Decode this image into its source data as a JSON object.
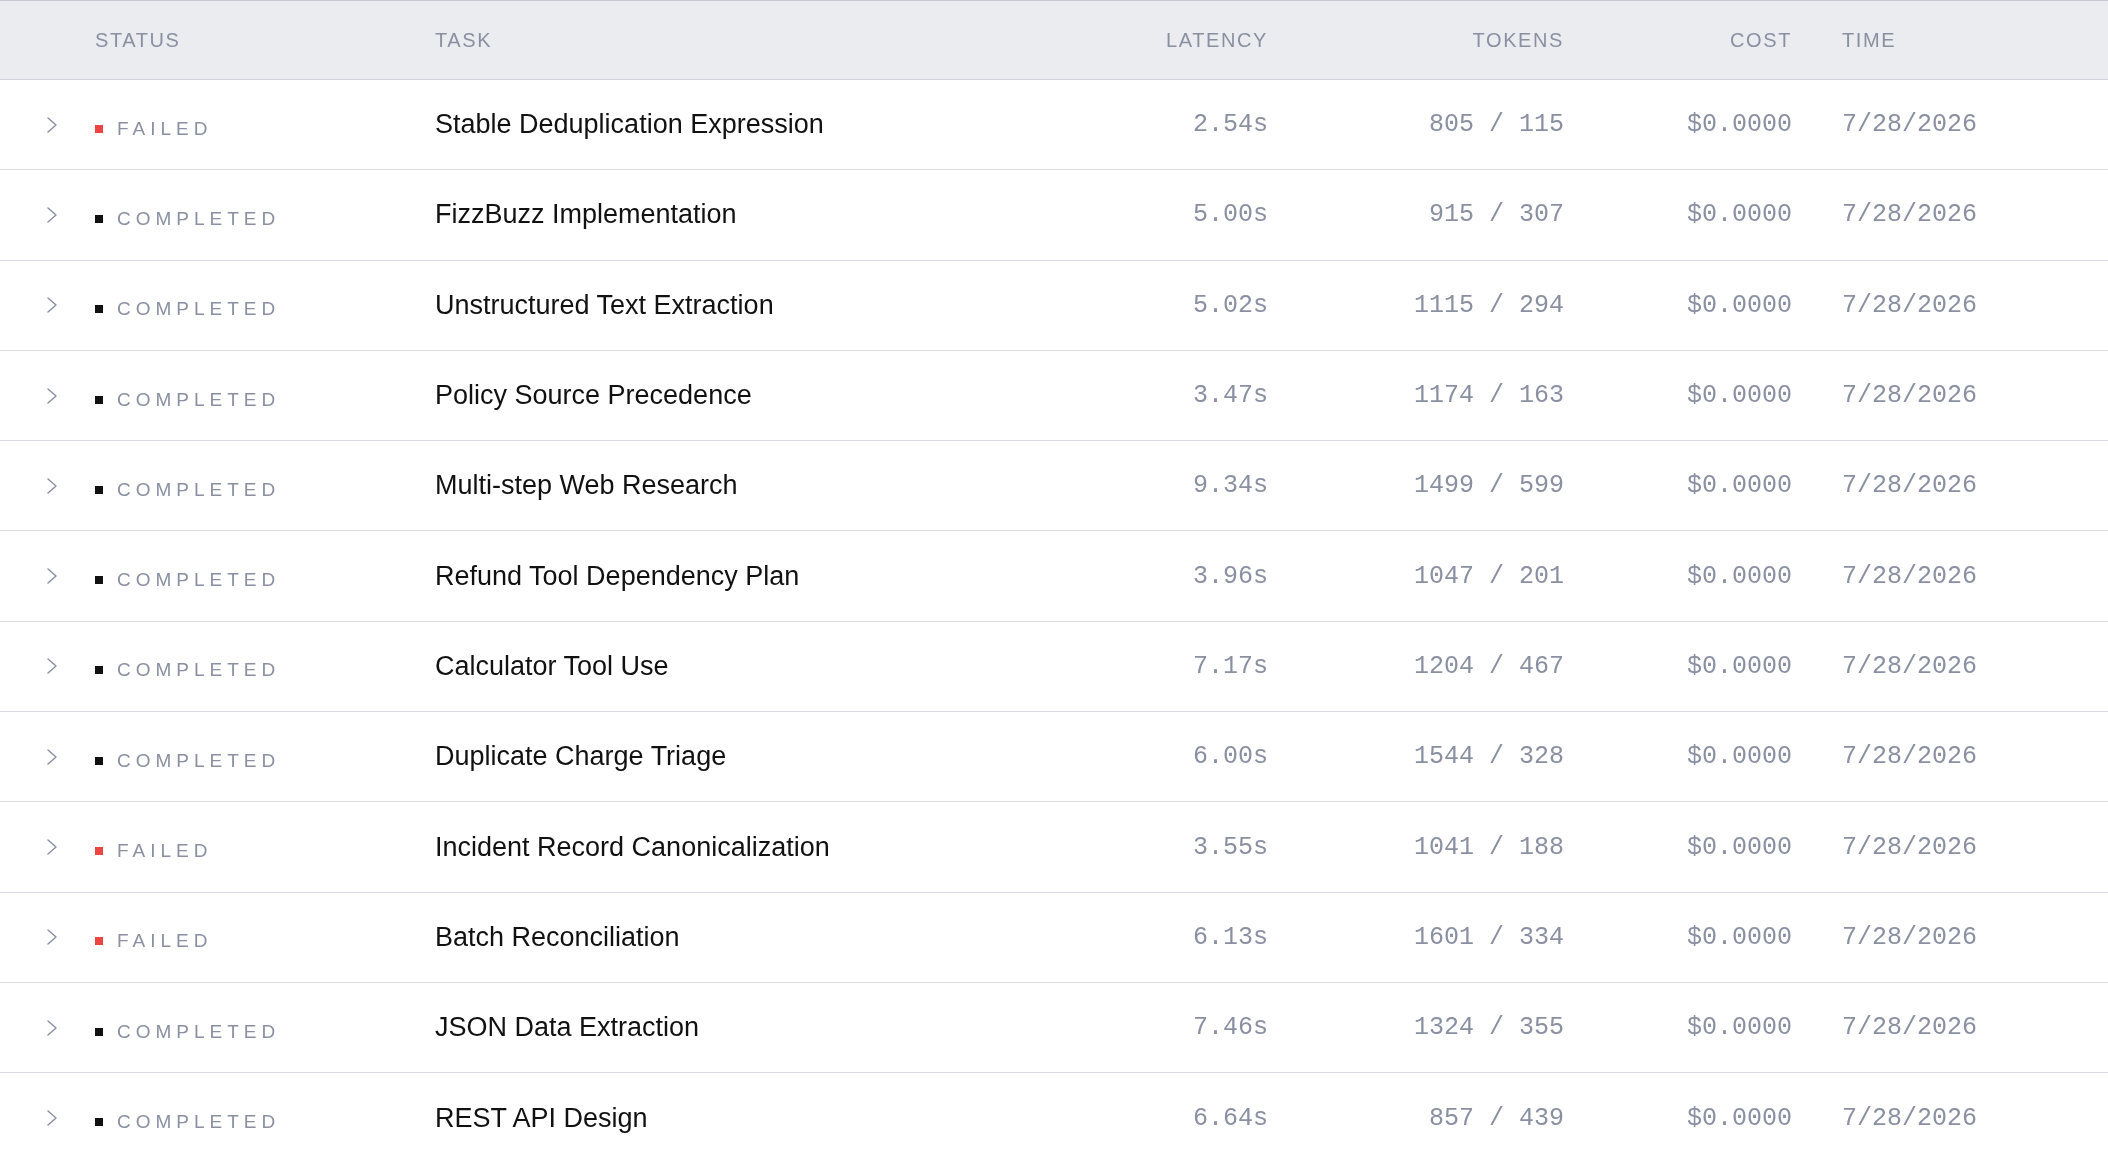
{
  "table": {
    "columns": [
      "STATUS",
      "TASK",
      "LATENCY",
      "TOKENS",
      "COST",
      "TIME"
    ],
    "rows": [
      {
        "expanded": false,
        "color": "#ef4444",
        "status": "FAILED",
        "task": "Stable Deduplication Expression",
        "latency": "2.54s",
        "tokens": "805 / 115",
        "cost": "$0.0000",
        "time": "7/28/2026"
      },
      {
        "expanded": false,
        "color": "#111111",
        "status": "COMPLETED",
        "task": "FizzBuzz Implementation",
        "latency": "5.00s",
        "tokens": "915 / 307",
        "cost": "$0.0000",
        "time": "7/28/2026"
      },
      {
        "expanded": false,
        "color": "#111111",
        "status": "COMPLETED",
        "task": "Unstructured Text Extraction",
        "latency": "5.02s",
        "tokens": "1115 / 294",
        "cost": "$0.0000",
        "time": "7/28/2026"
      },
      {
        "expanded": false,
        "color": "#111111",
        "status": "COMPLETED",
        "task": "Policy Source Precedence",
        "latency": "3.47s",
        "tokens": "1174 / 163",
        "cost": "$0.0000",
        "time": "7/28/2026"
      },
      {
        "expanded": false,
        "color": "#111111",
        "status": "COMPLETED",
        "task": "Multi-step Web Research",
        "latency": "9.34s",
        "tokens": "1499 / 599",
        "cost": "$0.0000",
        "time": "7/28/2026"
      },
      {
        "expanded": false,
        "color": "#111111",
        "status": "COMPLETED",
        "task": "Refund Tool Dependency Plan",
        "latency": "3.96s",
        "tokens": "1047 / 201",
        "cost": "$0.0000",
        "time": "7/28/2026"
      },
      {
        "expanded": false,
        "color": "#111111",
        "status": "COMPLETED",
        "task": "Calculator Tool Use",
        "latency": "7.17s",
        "tokens": "1204 / 467",
        "cost": "$0.0000",
        "time": "7/28/2026"
      },
      {
        "expanded": false,
        "color": "#111111",
        "status": "COMPLETED",
        "task": "Duplicate Charge Triage",
        "latency": "6.00s",
        "tokens": "1544 / 328",
        "cost": "$0.0000",
        "time": "7/28/2026"
      },
      {
        "expanded": false,
        "color": "#ef4444",
        "status": "FAILED",
        "task": "Incident Record Canonicalization",
        "latency": "3.55s",
        "tokens": "1041 / 188",
        "cost": "$0.0000",
        "time": "7/28/2026"
      },
      {
        "expanded": false,
        "color": "#ef4444",
        "status": "FAILED",
        "task": "Batch Reconciliation",
        "latency": "6.13s",
        "tokens": "1601 / 334",
        "cost": "$0.0000",
        "time": "7/28/2026"
      },
      {
        "expanded": false,
        "color": "#111111",
        "status": "COMPLETED",
        "task": "JSON Data Extraction",
        "latency": "7.46s",
        "tokens": "1324 / 355",
        "cost": "$0.0000",
        "time": "7/28/2026"
      },
      {
        "expanded": false,
        "color": "#111111",
        "status": "COMPLETED",
        "task": "REST API Design",
        "latency": "6.64s",
        "tokens": "857 / 439",
        "cost": "$0.0000",
        "time": "7/28/2026"
      }
    ]
  }
}
